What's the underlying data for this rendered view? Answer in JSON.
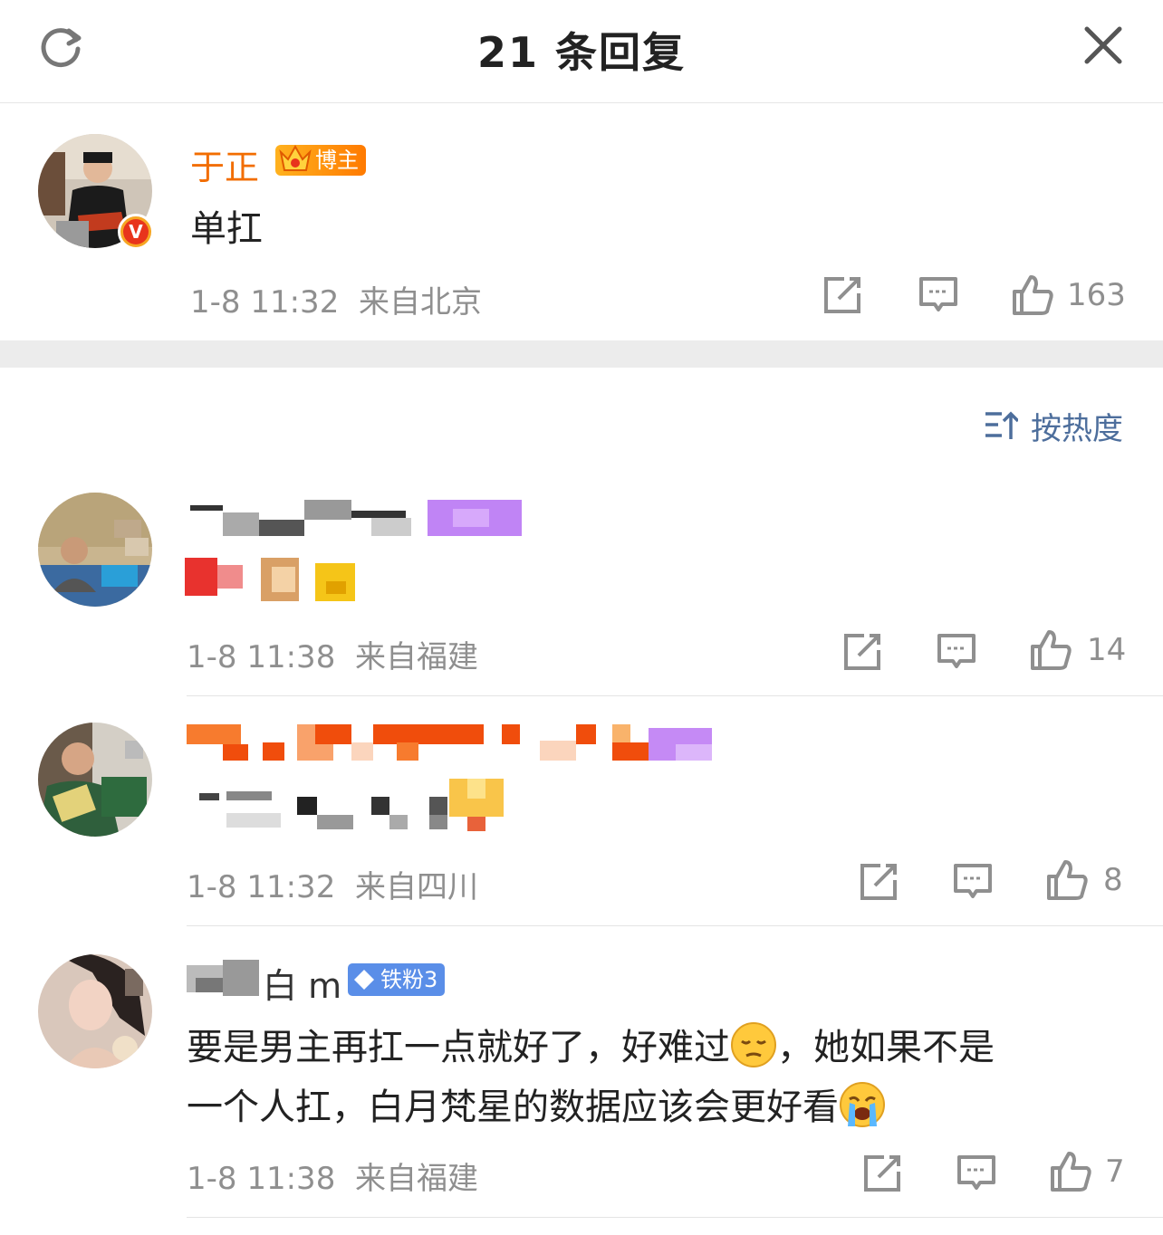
{
  "header": {
    "title": "21 条回复",
    "refresh_icon": "refresh-icon",
    "close_icon": "close-icon"
  },
  "main_comment": {
    "username": "于正",
    "badge": "博主",
    "text": "单扛",
    "time": "1-8 11:32",
    "location": "来自北京",
    "likes": "163",
    "verified": "V"
  },
  "sort": {
    "label": "按热度"
  },
  "replies": [
    {
      "time": "1-8 11:38",
      "location": "来自福建",
      "likes": "14"
    },
    {
      "time": "1-8 11:32",
      "location": "来自四川",
      "likes": "8"
    },
    {
      "username_visible": "白 m",
      "badge": "铁粉3",
      "text_line1": "要是男主再扛一点就好了，好难过",
      "text_line1b": "，她如果不是",
      "text_line2": "一个人扛，白月梵星的数据应该会更好看",
      "time": "1-8 11:38",
      "location": "来自福建",
      "likes": "7"
    }
  ],
  "colors": {
    "username_orange": "#f26d00",
    "meta_gray": "#8f8f8f",
    "sort_blue": "#4d6e9c",
    "fan_badge_blue": "#5a8ee8"
  }
}
